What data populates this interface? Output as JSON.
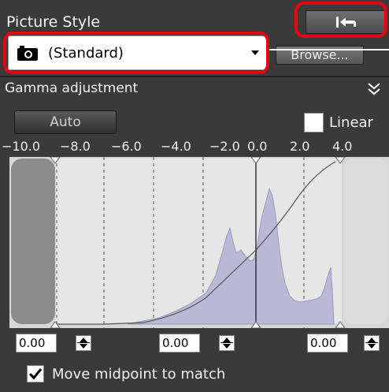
{
  "picture_style": {
    "title": "Picture Style",
    "selected": "(Standard)",
    "browse_label": "Browse..."
  },
  "gamma": {
    "title": "Gamma adjustment",
    "auto_label": "Auto",
    "linear_label": "Linear",
    "linear_checked": false,
    "ticks": [
      "−10.0",
      "−8.0",
      "−6.0",
      "−4.0",
      "−2.0",
      "0.0",
      "2.0",
      "4.0"
    ],
    "spin_left": "0.00",
    "spin_mid": "0.00",
    "spin_right": "0.00",
    "match_label": "Move midpoint to match",
    "match_checked": true
  },
  "icons": {
    "reset": "reset-arrow-icon",
    "camera": "camera-icon",
    "collapse": "double-chevron-down-icon"
  },
  "colors": {
    "panel_bg": "#3a3a3a",
    "highlight": "#e30613",
    "histogram_fill": "#b9b9d6"
  }
}
